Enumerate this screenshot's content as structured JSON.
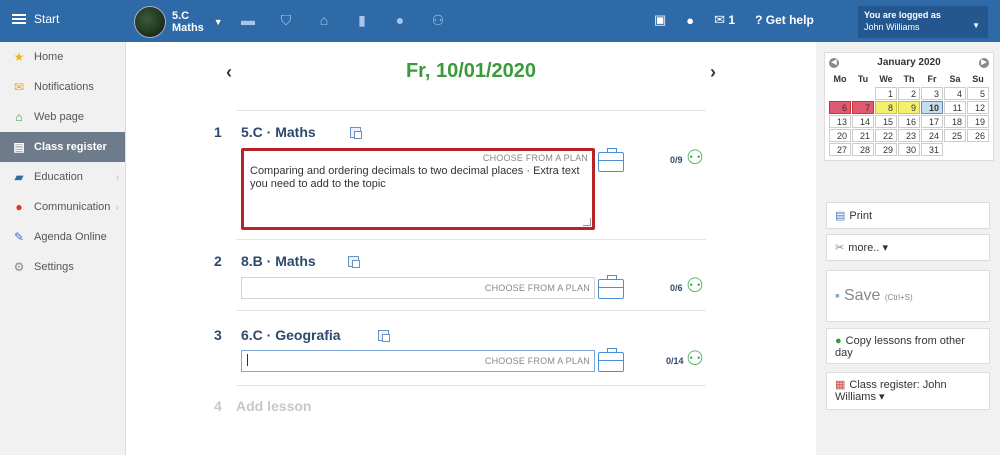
{
  "topbar": {
    "start_label": "Start",
    "class_name": "5.C",
    "class_subject": "Maths",
    "icons": [
      "briefcase-icon",
      "shield-icon",
      "bank-icon",
      "bar-chart-icon",
      "gauge-icon",
      "people-walking-icon"
    ],
    "cast_icon": "cast-icon",
    "chat_icon": "chat-icon",
    "mail_count": "1",
    "help_label": "Get help",
    "logged_label": "You are logged as",
    "user_name": "John Williams"
  },
  "sidebar": {
    "items": [
      {
        "label": "Home",
        "icon": "star-icon"
      },
      {
        "label": "Notifications",
        "icon": "envelope-icon"
      },
      {
        "label": "Web page",
        "icon": "house-icon"
      },
      {
        "label": "Class register",
        "icon": "register-icon"
      },
      {
        "label": "Education",
        "icon": "education-icon"
      },
      {
        "label": "Communication",
        "icon": "communication-icon"
      },
      {
        "label": "Agenda Online",
        "icon": "pen-icon"
      },
      {
        "label": "Settings",
        "icon": "gear-icon"
      }
    ]
  },
  "main": {
    "date": "Fr, 10/01/2020",
    "choose_plan": "CHOOSE FROM A PLAN",
    "lessons": [
      {
        "num": "1",
        "title": "5.C · Maths",
        "topic": "Comparing and ordering decimals to two decimal places · Extra text you need to add to the topic",
        "count": "0/9"
      },
      {
        "num": "2",
        "title": "8.B · Maths",
        "topic": "",
        "count": "0/6"
      },
      {
        "num": "3",
        "title": "6.C · Geografia",
        "topic": "",
        "count": "0/14"
      }
    ],
    "add_num": "4",
    "add_label": "Add lesson"
  },
  "calendar": {
    "month": "January 2020",
    "dows": [
      "Mo",
      "Tu",
      "We",
      "Th",
      "Fr",
      "Sa",
      "Su"
    ]
  },
  "actions": {
    "print": "Print",
    "more": "more.. ▾",
    "save": "Save",
    "save_hint": "(Ctrl+S)",
    "copy": "Copy lessons from other day",
    "register": "Class register: John Williams ▾"
  }
}
